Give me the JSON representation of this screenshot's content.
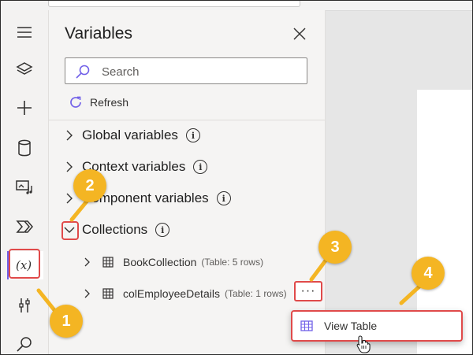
{
  "panel": {
    "title": "Variables",
    "search_placeholder": "Search",
    "refresh_label": "Refresh"
  },
  "sections": [
    {
      "label": "Global variables"
    },
    {
      "label": "Context variables"
    },
    {
      "label": "Component variables"
    },
    {
      "label": "Collections"
    }
  ],
  "collections": [
    {
      "name": "BookCollection",
      "meta": "(Table: 5 rows)"
    },
    {
      "name": "colEmployeeDetails",
      "meta": "(Table: 1 rows)"
    }
  ],
  "more_button": {
    "label": "···"
  },
  "context_menu": {
    "items": [
      {
        "label": "View Table"
      }
    ]
  },
  "callouts": [
    {
      "number": "1"
    },
    {
      "number": "2"
    },
    {
      "number": "3"
    },
    {
      "number": "4"
    }
  ],
  "colors": {
    "accent": "#7160e8",
    "callout": "#f4b523",
    "highlight": "#e04a4a"
  },
  "icons": {
    "rail": [
      "hamburger-icon",
      "layers-icon",
      "plus-icon",
      "database-icon",
      "media-icon",
      "power-automate-icon",
      "variables-icon",
      "tools-icon",
      "search-icon"
    ]
  }
}
